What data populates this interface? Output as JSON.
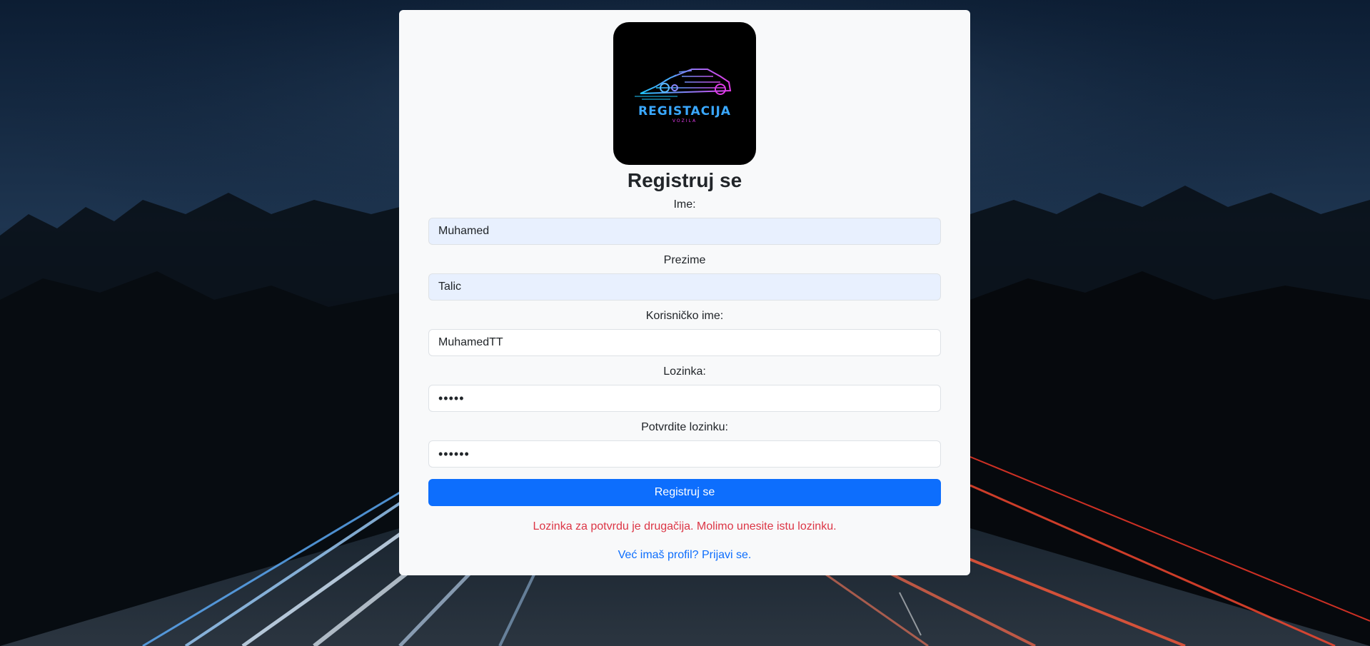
{
  "page": {
    "title": "Registruj se"
  },
  "logo": {
    "text": "REGISTACIJA",
    "subtext": "VOZILA"
  },
  "form": {
    "first_name": {
      "label": "Ime:",
      "value": "Muhamed"
    },
    "last_name": {
      "label": "Prezime",
      "value": "Talic"
    },
    "username": {
      "label": "Korisničko ime:",
      "value": "MuhamedTT"
    },
    "password": {
      "label": "Lozinka:",
      "value": "•••••"
    },
    "confirm_password": {
      "label": "Potvrdite lozinku:",
      "value": "••••••"
    },
    "submit_label": "Registruj se",
    "error_message": "Lozinka za potvrdu je drugačija. Molimo unesite istu lozinku.",
    "login_link": "Već imaš profil? Prijavi se."
  },
  "colors": {
    "primary": "#0d6efd",
    "error": "#dc3545",
    "card_bg": "#f8f9fa",
    "autofill_bg": "#e8f0fe"
  }
}
